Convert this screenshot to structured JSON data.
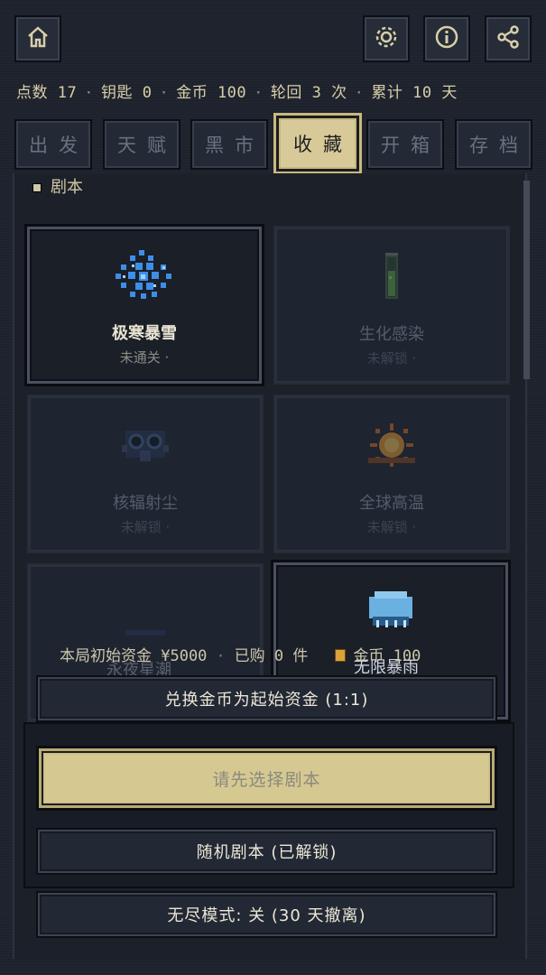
{
  "header": {
    "home_icon": "home-icon",
    "settings_icon": "gear-icon",
    "info_icon": "info-icon",
    "share_icon": "share-icon"
  },
  "stats": {
    "points": "点数 17",
    "keys": "钥匙 0",
    "coins": "金币 100",
    "rounds": "轮回 3 次",
    "total": "累计 10 天"
  },
  "tabs": [
    {
      "label": "出发"
    },
    {
      "label": "天赋"
    },
    {
      "label": "黑市"
    },
    {
      "label": "收藏"
    },
    {
      "label": "开箱"
    },
    {
      "label": "存档"
    }
  ],
  "section": {
    "label": "剧本"
  },
  "scenarios": [
    {
      "name": "极寒暴雪",
      "status": "未通关 ·",
      "icon": "snowflake-icon"
    },
    {
      "name": "生化感染",
      "status": "未解锁 ·",
      "icon": "test-tube-icon"
    },
    {
      "name": "核辐射尘",
      "status": "未解锁 ·",
      "icon": "gas-mask-icon"
    },
    {
      "name": "全球高温",
      "status": "未解锁 ·",
      "icon": "sun-icon"
    },
    {
      "name": "永夜星潮",
      "status": "",
      "icon": "moon-icon"
    },
    {
      "name": "无限暴雨",
      "status": "",
      "icon": "cloud-icon"
    }
  ],
  "fund": {
    "initial": "本局初始资金 ¥5000",
    "bought": "已购 0 件",
    "coins": "金币 100"
  },
  "actions": {
    "exchange": "兑换金币为起始资金 (1:1)",
    "select_prompt": "请先选择剧本",
    "random": "随机剧本 (已解锁)",
    "endless": "无尽模式: 关 (30 天撤离)"
  },
  "colors": {
    "accent": "#d6c891",
    "background": "#1d222d",
    "text": "#ece7d6"
  }
}
